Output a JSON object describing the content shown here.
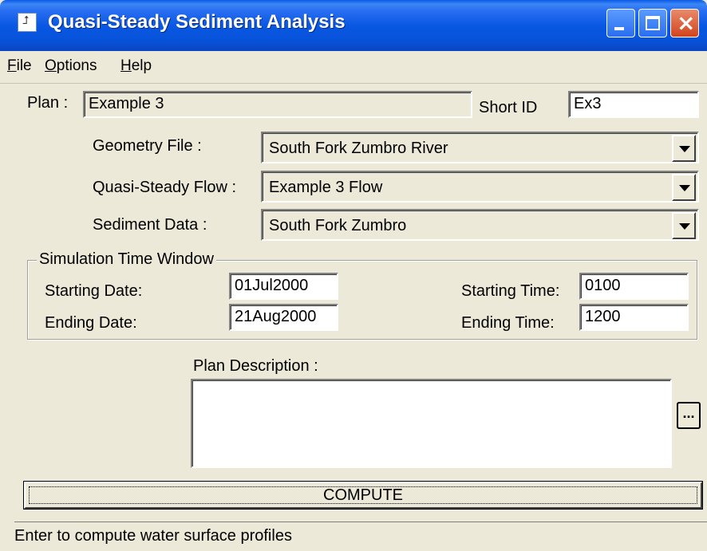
{
  "window": {
    "title": "Quasi-Steady Sediment Analysis",
    "app_icon": "hec-ras-icon"
  },
  "menu": [
    {
      "label": "File",
      "underline": "F",
      "rest": "ile"
    },
    {
      "label": "Options",
      "underline": "O",
      "rest": "ptions"
    },
    {
      "label": "Help",
      "underline": "H",
      "rest": "elp"
    }
  ],
  "plan": {
    "label": "Plan :",
    "value": "Example 3",
    "short_id_label": "Short ID",
    "short_id_value": "Ex3"
  },
  "files": {
    "geometry": {
      "label": "Geometry File :",
      "value": "South Fork Zumbro River"
    },
    "flow": {
      "label": "Quasi-Steady Flow :",
      "value": "Example 3 Flow"
    },
    "sediment": {
      "label": "Sediment Data :",
      "value": "South Fork Zumbro"
    }
  },
  "time_window": {
    "title": "Simulation Time Window",
    "start_date_label": "Starting Date:",
    "start_date": "01Jul2000",
    "end_date_label": "Ending Date:",
    "end_date": "21Aug2000",
    "start_time_label": "Starting Time:",
    "start_time": "0100",
    "end_time_label": "Ending Time:",
    "end_time": "1200"
  },
  "description": {
    "label": "Plan Description :",
    "value": "",
    "browse_label": "..."
  },
  "compute_label": "COMPUTE",
  "status": "Enter to compute water surface profiles"
}
